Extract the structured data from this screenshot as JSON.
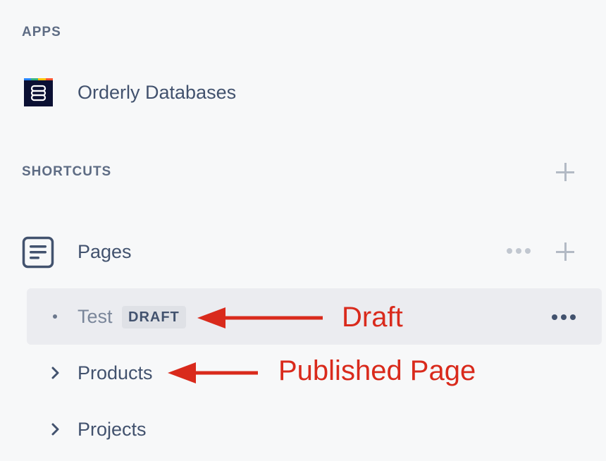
{
  "apps": {
    "section_title": "APPS",
    "items": [
      {
        "label": "Orderly Databases",
        "icon": "orderly-databases-logo",
        "icon_colors": {
          "background": "#0B1033",
          "strip": [
            "#2684FF",
            "#36B37E",
            "#FFC400",
            "#FF5630"
          ]
        }
      }
    ]
  },
  "shortcuts": {
    "section_title": "SHORTCUTS",
    "add_icon": "plus-icon"
  },
  "pages": {
    "label": "Pages",
    "icon": "document-icon",
    "more_icon": "more-dots-icon",
    "add_icon": "plus-icon",
    "tree": [
      {
        "label": "Test",
        "badge": "DRAFT",
        "status": "draft",
        "selected": true,
        "marker": "bullet",
        "more_icon": "more-dots-icon"
      },
      {
        "label": "Products",
        "status": "published",
        "marker": "chevron-right-icon"
      },
      {
        "label": "Projects",
        "status": "published",
        "marker": "chevron-right-icon"
      }
    ]
  },
  "annotations": {
    "draft": "Draft",
    "published": "Published Page",
    "color": "#D92A1C"
  },
  "colors": {
    "background": "#F7F8F9",
    "text": "#42526E",
    "muted": "#5E6C84",
    "selected_background": "#EBECF0",
    "badge_background": "#DFE1E6"
  }
}
